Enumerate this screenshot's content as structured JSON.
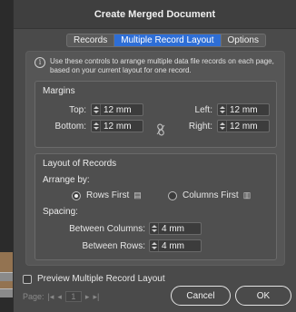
{
  "window": {
    "title": "Create Merged Document"
  },
  "tabs": [
    {
      "label": "Records",
      "active": false
    },
    {
      "label": "Multiple Record Layout",
      "active": true
    },
    {
      "label": "Options",
      "active": false
    }
  ],
  "info": {
    "text": "Use these controls to arrange multiple data file records on each page, based on your current layout for one record."
  },
  "margins": {
    "title": "Margins",
    "top": {
      "label": "Top:",
      "value": "12 mm"
    },
    "bottom": {
      "label": "Bottom:",
      "value": "12 mm"
    },
    "left": {
      "label": "Left:",
      "value": "12 mm"
    },
    "right": {
      "label": "Right:",
      "value": "12 mm"
    }
  },
  "layout": {
    "title": "Layout of Records",
    "arrange_label": "Arrange by:",
    "rows_first": {
      "label": "Rows First",
      "selected": true
    },
    "columns_first": {
      "label": "Columns First",
      "selected": false
    },
    "spacing_label": "Spacing:",
    "between_columns": {
      "label": "Between Columns:",
      "value": "4 mm"
    },
    "between_rows": {
      "label": "Between Rows:",
      "value": "4 mm"
    }
  },
  "preview": {
    "label": "Preview Multiple Record Layout",
    "checked": false
  },
  "pager": {
    "label": "Page:",
    "first": "|◂",
    "prev": "◂",
    "value": "1",
    "next": "▸",
    "last": "▸|"
  },
  "buttons": {
    "cancel": "Cancel",
    "ok": "OK"
  },
  "colors": {
    "accent": "#2e6ed6",
    "dialog_bg": "#4a4a4a",
    "panel_bg": "#565656"
  }
}
